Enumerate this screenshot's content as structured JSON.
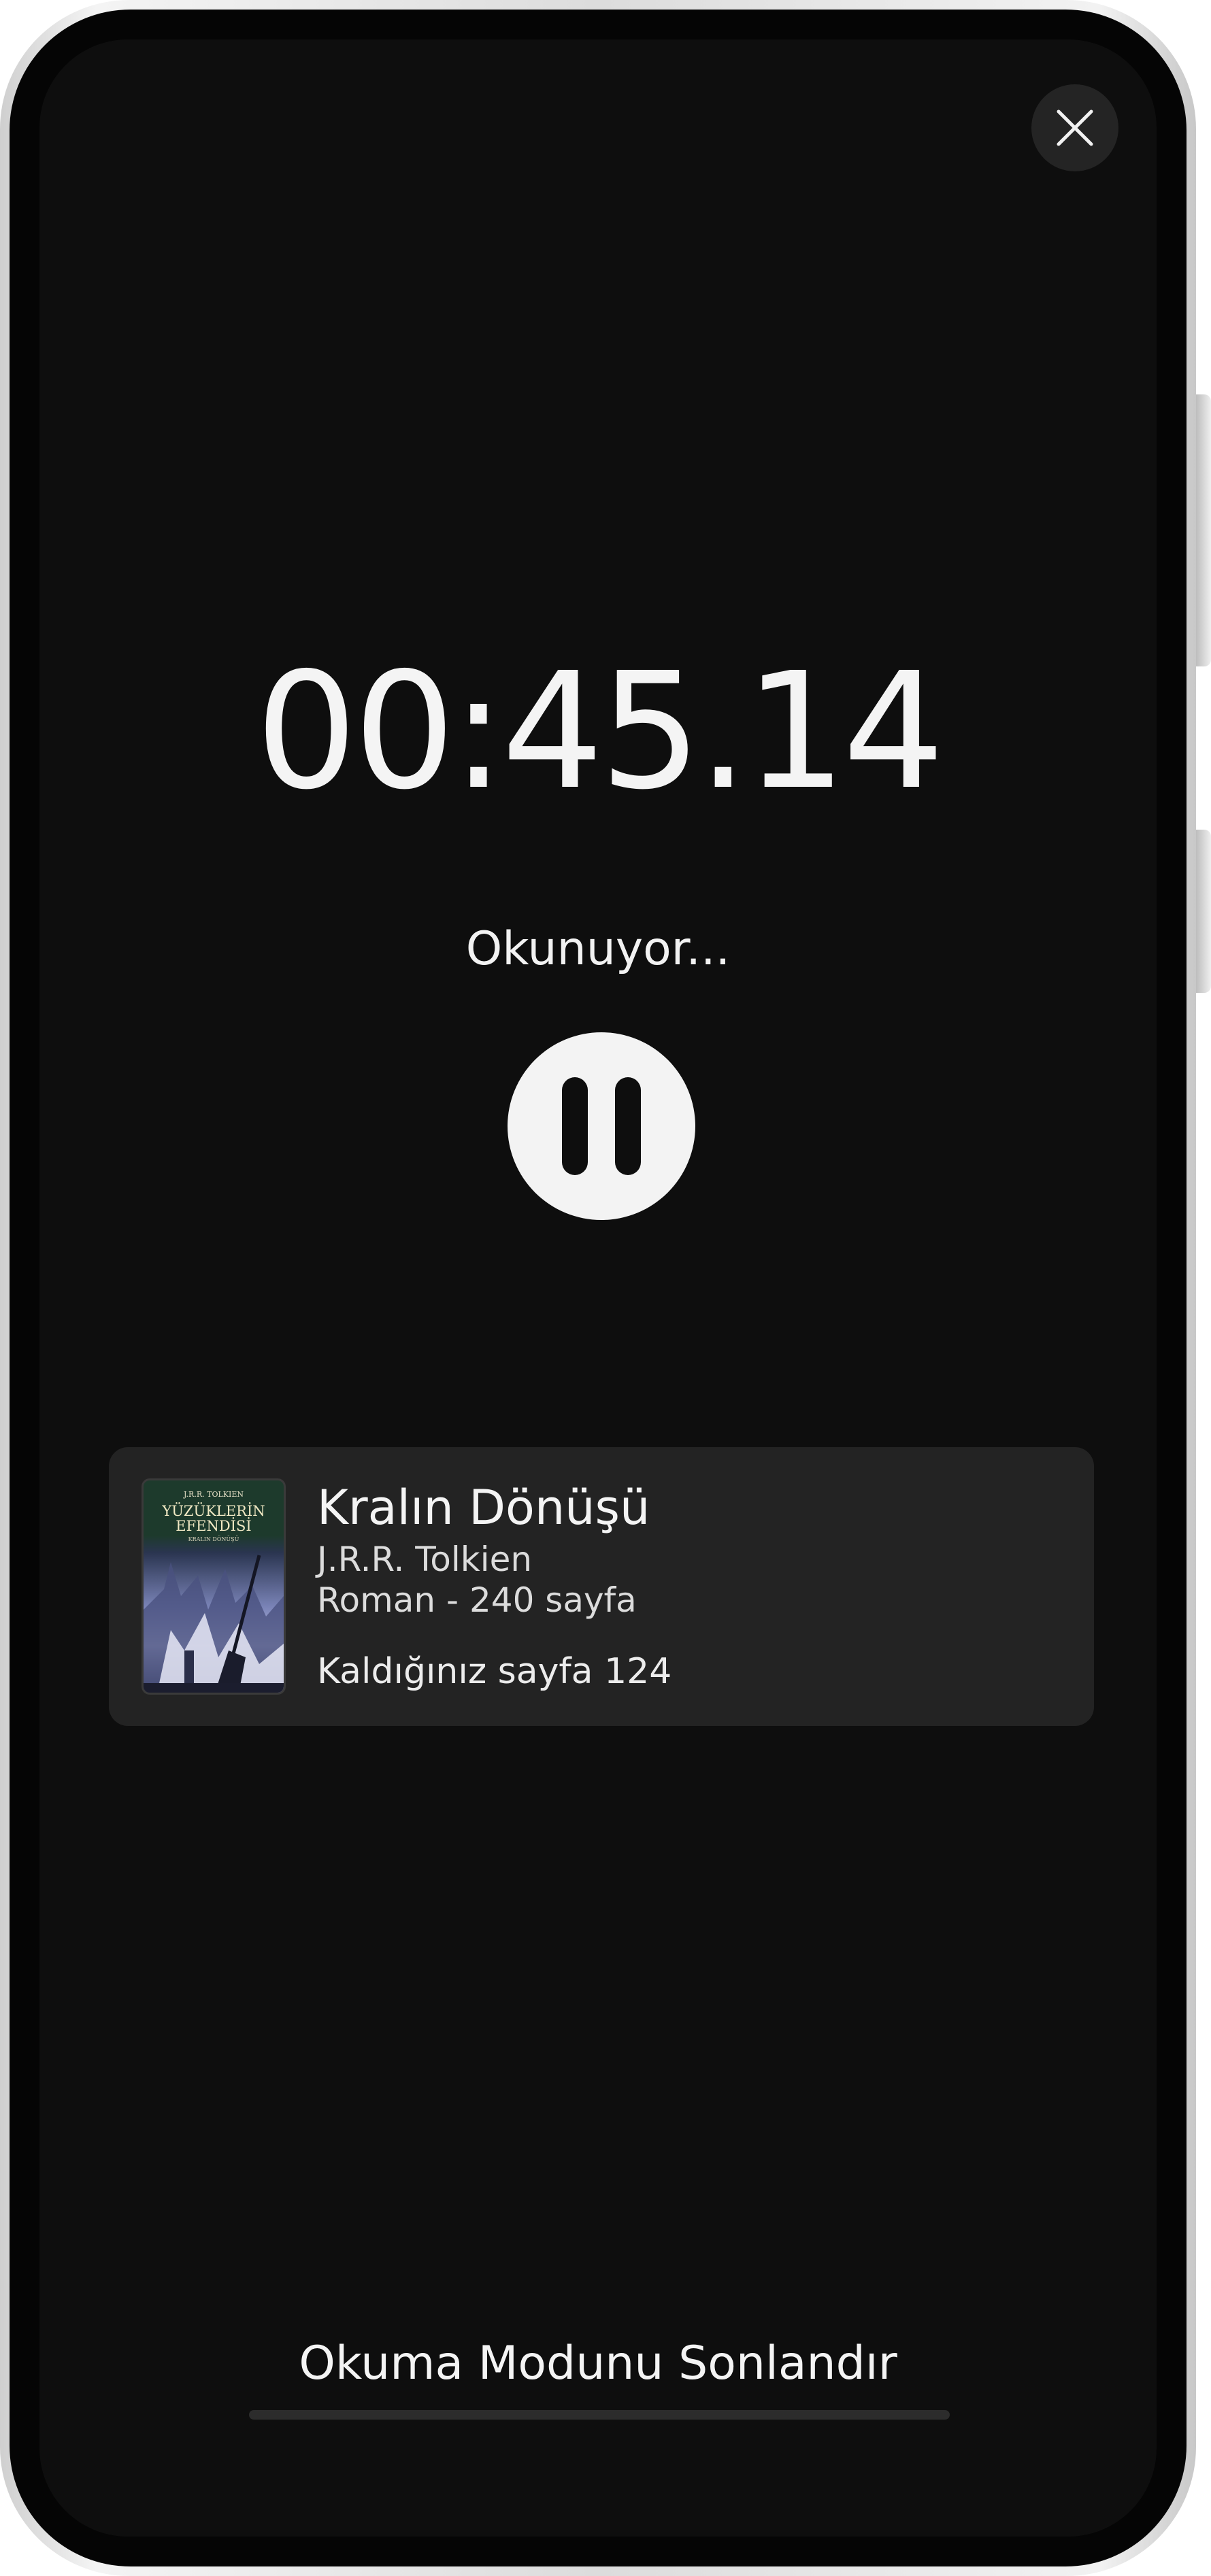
{
  "timer": {
    "display": "00:45.14"
  },
  "status": {
    "label": "Okunuyor..."
  },
  "book": {
    "title": "Kralın Dönüşü",
    "author": "J.R.R. Tolkien",
    "meta": "Roman - 240 sayfa",
    "progress": "Kaldığınız sayfa 124",
    "cover": {
      "author": "J.R.R. TOLKIEN",
      "series_line1": "YÜZÜKLERİN",
      "series_line2": "EFENDİSİ",
      "subtitle": "KRALIN DÖNÜŞÜ"
    }
  },
  "actions": {
    "end_label": "Okuma Modunu Sonlandır"
  },
  "icons": {
    "close": "close-icon",
    "pause": "pause-icon"
  },
  "colors": {
    "background": "#0e0e0e",
    "card": "#232323",
    "text": "#f4f4f4",
    "button": "#f3f3f3"
  }
}
